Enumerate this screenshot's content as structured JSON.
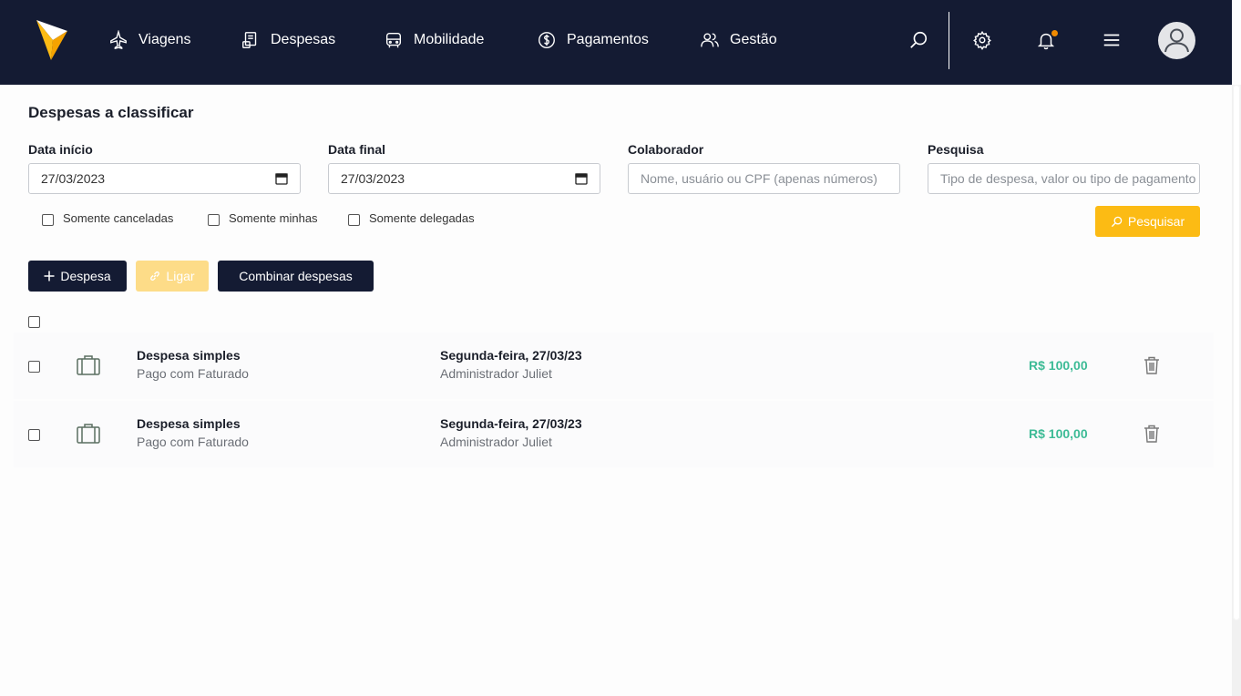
{
  "nav": {
    "items": [
      {
        "label": "Viagens",
        "icon": "plane-icon"
      },
      {
        "label": "Despesas",
        "icon": "receipt-icon"
      },
      {
        "label": "Mobilidade",
        "icon": "car-icon"
      },
      {
        "label": "Pagamentos",
        "icon": "dollar-icon"
      },
      {
        "label": "Gestão",
        "icon": "users-icon"
      }
    ],
    "right_icons": [
      "search-icon",
      "gear-icon",
      "bell-icon",
      "menu-icon",
      "avatar-icon"
    ],
    "bg_color": "#141b33",
    "accent_color": "#fcbb14"
  },
  "page": {
    "title": "Despesas a classificar"
  },
  "filters": {
    "start_date": {
      "label": "Data início",
      "value": "27/03/2023"
    },
    "end_date": {
      "label": "Data final",
      "value": "27/03/2023"
    },
    "collaborator": {
      "label": "Colaborador",
      "placeholder": "Nome, usuário ou CPF (apenas números)"
    },
    "search": {
      "label": "Pesquisa",
      "placeholder": "Tipo de despesa, valor ou tipo de pagamento"
    },
    "checkboxes": [
      {
        "label": "Somente canceladas",
        "checked": false
      },
      {
        "label": "Somente minhas",
        "checked": false
      },
      {
        "label": "Somente delegadas",
        "checked": false
      }
    ],
    "search_button": "Pesquisar"
  },
  "actions": {
    "add_expense": "Despesa",
    "link": "Ligar",
    "combine": "Combinar despesas"
  },
  "expenses": [
    {
      "type": "Despesa simples",
      "payment": "Pago com Faturado",
      "date": "Segunda-feira, 27/03/23",
      "user": "Administrador Juliet",
      "amount": "R$ 100,00"
    },
    {
      "type": "Despesa simples",
      "payment": "Pago com Faturado",
      "date": "Segunda-feira, 27/03/23",
      "user": "Administrador Juliet",
      "amount": "R$ 100,00"
    }
  ],
  "colors": {
    "amount": "#3dbb96",
    "primary_dark": "#141b33"
  }
}
